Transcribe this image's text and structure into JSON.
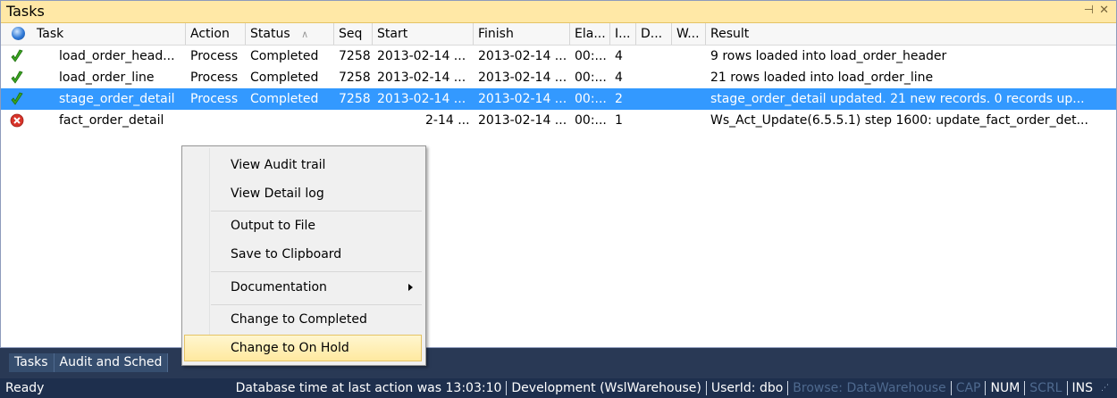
{
  "panel": {
    "title": "Tasks",
    "pin_icon": "pin-icon",
    "close_icon": "close-icon",
    "pin_glyph": "⊣",
    "close_glyph": "✕"
  },
  "columns": {
    "task": "Task",
    "action": "Action",
    "status": "Status",
    "status_sort": "∧",
    "seq": "Seq",
    "start": "Start",
    "finish": "Finish",
    "elapsed": "Ela...",
    "i": "I...",
    "d": "D...",
    "w": "W...",
    "result": "Result"
  },
  "rows": [
    {
      "icon": "success-check-icon",
      "task": "load_order_head...",
      "action": "Process",
      "status": "Completed",
      "seq": "7258",
      "start": "2013-02-14 ...",
      "finish": "2013-02-14 ...",
      "elapsed": "00:...",
      "i": "4",
      "result": "9 rows loaded into load_order_header"
    },
    {
      "icon": "success-check-icon",
      "task": "load_order_line",
      "action": "Process",
      "status": "Completed",
      "seq": "7258",
      "start": "2013-02-14 ...",
      "finish": "2013-02-14 ...",
      "elapsed": "00:...",
      "i": "4",
      "result": "21 rows loaded into load_order_line"
    },
    {
      "icon": "success-check-icon",
      "task": "stage_order_detail",
      "action": "Process",
      "status": "Completed",
      "seq": "7258",
      "start": "2013-02-14 ...",
      "finish": "2013-02-14 ...",
      "elapsed": "00:...",
      "i": "2",
      "result": "stage_order_detail updated. 21 new records. 0 records up..."
    },
    {
      "icon": "error-icon",
      "task": "fact_order_detail",
      "action": "",
      "status": "",
      "seq": "",
      "start": "2-14 ...",
      "finish": "2013-02-14 ...",
      "elapsed": "00:...",
      "i": "1",
      "result": "Ws_Act_Update(6.5.5.1) step 1600: update_fact_order_det..."
    }
  ],
  "context_menu": {
    "view_audit_trail": "View Audit trail",
    "view_detail_log": "View Detail log",
    "output_to_file": "Output to File",
    "save_to_clipboard": "Save to Clipboard",
    "documentation": "Documentation",
    "change_to_completed": "Change to Completed",
    "change_to_on_hold": "Change to On Hold"
  },
  "bottom_tabs": {
    "tasks": "Tasks",
    "audit": "Audit and Sched"
  },
  "statusbar": {
    "ready": "Ready",
    "db_time": "Database time at last action was 13:03:10",
    "environment": "Development (WslWarehouse)",
    "userid": "UserId: dbo",
    "browse": "Browse: DataWarehouse",
    "cap": "CAP",
    "num": "NUM",
    "scrl": "SCRL",
    "ins": "INS"
  },
  "colors": {
    "title_bg": "#ffe8a6",
    "selection": "#3399ff",
    "statusbar_bg": "#1e2f4d",
    "success": "#3aa51f",
    "error": "#d8342a"
  }
}
